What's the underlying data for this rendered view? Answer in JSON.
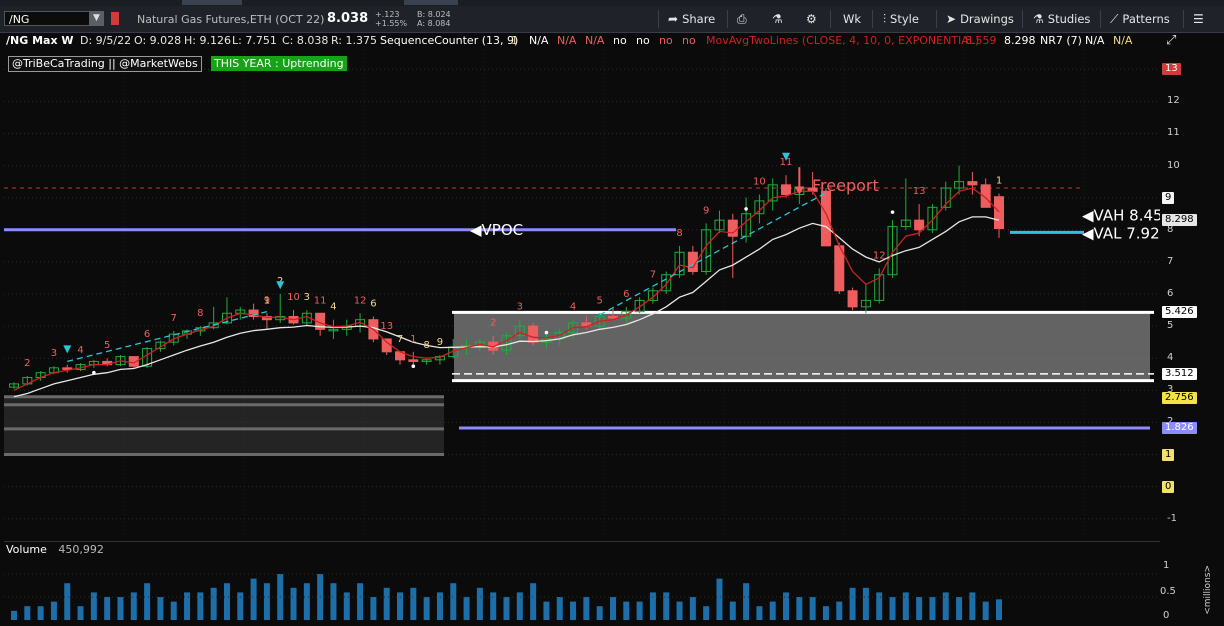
{
  "toolbar": {
    "symbol": "/NG",
    "description": "Natural Gas Futures,ETH (OCT 22)",
    "last": "8.038",
    "change": "+.123",
    "change_pct": "+1.55%",
    "bid": "B: 8.024",
    "ask": "A: 8.084",
    "share": "Share",
    "period": "Wk",
    "style": "Style",
    "drawings": "Drawings",
    "studies": "Studies",
    "patterns": "Patterns"
  },
  "header": {
    "symbol_period": "/NG Max W",
    "date": "D: 9/5/22",
    "open": "O: 9.028",
    "high": "H: 9.126",
    "low": "L: 7.751",
    "close": "C: 8.038",
    "range": "R: 1.375",
    "study1": "SequenceCounter (13, 9)",
    "s1": "1",
    "na1": "N/A",
    "na2": "N/A",
    "na3": "N/A",
    "no1": "no",
    "no2": "no",
    "no3": "no",
    "no4": "no",
    "study2": "MovAvgTwoLines (CLOSE, 4, 10, 0, EXPONENTIAL)",
    "ma1": "8.559",
    "ma2": "8.298",
    "study3": "NR7 (7)",
    "na4": "N/A",
    "na5": "N/A"
  },
  "tags": {
    "author": "@TriBeCaTrading || @MarketWebs",
    "trend": "THIS YEAR : Uptrending"
  },
  "annotations": {
    "vpoc": "VPOC",
    "vah": "VAH  8.45",
    "val": "VAL 7.92",
    "freeport": "Freeport"
  },
  "y_axis": {
    "labels": [
      "13",
      "12",
      "11",
      "10",
      "9",
      "8",
      "7",
      "6",
      "5",
      "4",
      "3",
      "2",
      "1",
      "0",
      "-1"
    ],
    "boxes": {
      "b13": "13",
      "b9": "9",
      "last": "8.298",
      "top": "5.426",
      "mid": "3.512",
      "low": "2.756",
      "vpoc_low": "1.826",
      "one": "1",
      "zero": "0"
    }
  },
  "volume": {
    "label": "Volume",
    "value": "450,992",
    "axis": [
      "1",
      "0.5",
      "0"
    ],
    "unit": "<millions>"
  },
  "colors": {
    "up": "#1fae3a",
    "down": "#ef5e5e",
    "ma_fast": "#d21f1f",
    "ma_slow": "#e6e6e6",
    "cyan": "#29c6d8",
    "vpoc": "#8c8cff",
    "vol": "#1c6fa8"
  },
  "chart_data": {
    "type": "candlestick",
    "candles": [
      [
        3.1,
        3.25,
        3.05,
        3.2
      ],
      [
        3.2,
        3.45,
        3.15,
        3.4
      ],
      [
        3.4,
        3.6,
        3.3,
        3.55
      ],
      [
        3.55,
        3.75,
        3.5,
        3.7
      ],
      [
        3.7,
        3.8,
        3.55,
        3.65
      ],
      [
        3.65,
        3.85,
        3.6,
        3.8
      ],
      [
        3.8,
        3.95,
        3.7,
        3.9
      ],
      [
        3.9,
        4.0,
        3.75,
        3.8
      ],
      [
        3.8,
        4.1,
        3.75,
        4.05
      ],
      [
        4.05,
        4.0,
        3.7,
        3.75
      ],
      [
        3.75,
        4.35,
        3.7,
        4.3
      ],
      [
        4.3,
        4.55,
        4.2,
        4.5
      ],
      [
        4.5,
        4.85,
        4.4,
        4.75
      ],
      [
        4.75,
        4.9,
        4.6,
        4.85
      ],
      [
        4.85,
        5.0,
        4.7,
        4.95
      ],
      [
        4.95,
        5.6,
        4.9,
        5.1
      ],
      [
        5.1,
        5.9,
        5.05,
        5.4
      ],
      [
        5.4,
        5.6,
        5.2,
        5.5
      ],
      [
        5.5,
        5.7,
        5.2,
        5.3
      ],
      [
        5.3,
        5.4,
        4.9,
        5.2
      ],
      [
        5.2,
        6.0,
        5.1,
        5.3
      ],
      [
        5.3,
        5.5,
        5.05,
        5.1
      ],
      [
        5.1,
        5.5,
        5.0,
        5.4
      ],
      [
        5.4,
        5.4,
        4.7,
        4.9
      ],
      [
        4.9,
        5.2,
        4.6,
        4.9
      ],
      [
        4.9,
        5.2,
        4.7,
        5.0
      ],
      [
        5.0,
        5.4,
        4.8,
        5.2
      ],
      [
        5.2,
        5.3,
        4.5,
        4.6
      ],
      [
        4.6,
        4.6,
        4.1,
        4.2
      ],
      [
        4.2,
        4.2,
        3.8,
        3.95
      ],
      [
        3.95,
        4.2,
        3.8,
        3.9
      ],
      [
        3.9,
        4.0,
        3.8,
        3.95
      ],
      [
        3.95,
        4.1,
        3.8,
        4.05
      ],
      [
        4.05,
        4.6,
        4.0,
        4.35
      ],
      [
        4.35,
        4.6,
        4.1,
        4.4
      ],
      [
        4.4,
        4.6,
        4.2,
        4.5
      ],
      [
        4.5,
        4.7,
        4.1,
        4.25
      ],
      [
        4.25,
        4.8,
        4.1,
        4.7
      ],
      [
        4.7,
        5.2,
        4.6,
        5.0
      ],
      [
        5.0,
        5.1,
        4.4,
        4.5
      ],
      [
        4.5,
        4.8,
        4.3,
        4.6
      ],
      [
        4.6,
        4.9,
        4.4,
        4.8
      ],
      [
        4.8,
        5.2,
        4.6,
        5.1
      ],
      [
        5.1,
        5.3,
        4.9,
        5.0
      ],
      [
        5.0,
        5.4,
        4.9,
        5.3
      ],
      [
        5.3,
        5.6,
        5.2,
        5.25
      ],
      [
        5.25,
        5.6,
        5.1,
        5.45
      ],
      [
        5.45,
        5.9,
        5.4,
        5.8
      ],
      [
        5.8,
        6.2,
        5.7,
        6.1
      ],
      [
        6.1,
        6.7,
        6.0,
        6.6
      ],
      [
        6.6,
        7.5,
        6.5,
        7.3
      ],
      [
        7.3,
        7.5,
        6.6,
        6.7
      ],
      [
        6.7,
        8.2,
        6.6,
        8.0
      ],
      [
        8.0,
        8.6,
        7.9,
        8.3
      ],
      [
        8.3,
        8.5,
        6.5,
        7.8
      ],
      [
        7.8,
        9.0,
        7.6,
        8.5
      ],
      [
        8.5,
        9.1,
        8.2,
        8.9
      ],
      [
        8.9,
        9.6,
        8.6,
        9.4
      ],
      [
        9.4,
        9.7,
        9.0,
        9.1
      ],
      [
        9.1,
        9.6,
        8.8,
        9.3
      ],
      [
        9.3,
        9.8,
        9.1,
        9.2
      ],
      [
        9.2,
        9.3,
        7.6,
        7.5
      ],
      [
        7.5,
        7.6,
        6.0,
        6.1
      ],
      [
        6.1,
        6.2,
        5.5,
        5.6
      ],
      [
        5.6,
        6.3,
        5.4,
        5.8
      ],
      [
        5.8,
        6.8,
        5.7,
        6.6
      ],
      [
        6.6,
        8.3,
        6.5,
        8.1
      ],
      [
        8.1,
        9.6,
        8.0,
        8.3
      ],
      [
        8.3,
        8.8,
        7.8,
        8.0
      ],
      [
        8.0,
        8.8,
        7.9,
        8.7
      ],
      [
        8.7,
        9.5,
        8.6,
        9.3
      ],
      [
        9.3,
        10.0,
        9.1,
        9.5
      ],
      [
        9.5,
        9.8,
        9.1,
        9.4
      ],
      [
        9.4,
        9.6,
        8.8,
        8.7
      ],
      [
        9.03,
        9.13,
        7.75,
        8.04
      ]
    ],
    "ma_fast": [
      3.0,
      3.2,
      3.4,
      3.55,
      3.62,
      3.7,
      3.8,
      3.8,
      3.92,
      3.85,
      4.1,
      4.35,
      4.6,
      4.75,
      4.88,
      5.0,
      5.25,
      5.4,
      5.35,
      5.27,
      5.28,
      5.2,
      5.3,
      5.1,
      4.98,
      5.0,
      5.12,
      4.9,
      4.5,
      4.2,
      4.05,
      4.0,
      4.03,
      4.22,
      4.33,
      4.43,
      4.35,
      4.55,
      4.8,
      4.65,
      4.63,
      4.72,
      4.95,
      4.98,
      5.15,
      5.2,
      5.35,
      5.6,
      5.9,
      6.3,
      6.9,
      6.82,
      7.5,
      7.95,
      7.9,
      8.25,
      8.6,
      9.0,
      9.05,
      9.2,
      9.2,
      8.5,
      7.5,
      6.7,
      6.3,
      6.5,
      7.3,
      7.8,
      7.9,
      8.3,
      8.8,
      9.2,
      9.3,
      9.0,
      8.56
    ],
    "ma_slow": [
      2.8,
      2.9,
      3.05,
      3.2,
      3.3,
      3.4,
      3.5,
      3.55,
      3.65,
      3.68,
      3.8,
      3.95,
      4.1,
      4.25,
      4.38,
      4.5,
      4.65,
      4.78,
      4.86,
      4.9,
      4.95,
      4.97,
      5.02,
      4.98,
      4.96,
      4.97,
      5.0,
      4.95,
      4.82,
      4.66,
      4.5,
      4.4,
      4.33,
      4.34,
      4.35,
      4.36,
      4.35,
      4.42,
      4.53,
      4.52,
      4.55,
      4.6,
      4.73,
      4.8,
      4.9,
      4.96,
      5.05,
      5.2,
      5.38,
      5.6,
      5.9,
      6.05,
      6.4,
      6.75,
      6.9,
      7.15,
      7.4,
      7.7,
      7.85,
      8.05,
      8.2,
      8.1,
      7.75,
      7.4,
      7.15,
      7.0,
      7.2,
      7.35,
      7.45,
      7.7,
      7.95,
      8.25,
      8.4,
      8.4,
      8.3
    ],
    "volume": [
      0.2,
      0.3,
      0.3,
      0.4,
      0.8,
      0.3,
      0.6,
      0.5,
      0.5,
      0.6,
      0.8,
      0.5,
      0.4,
      0.6,
      0.6,
      0.7,
      0.8,
      0.6,
      0.9,
      0.8,
      1.0,
      0.7,
      0.8,
      1.0,
      0.8,
      0.6,
      0.8,
      0.5,
      0.7,
      0.6,
      0.7,
      0.5,
      0.6,
      0.8,
      0.5,
      0.7,
      0.6,
      0.5,
      0.6,
      0.8,
      0.4,
      0.5,
      0.4,
      0.5,
      0.3,
      0.5,
      0.4,
      0.4,
      0.6,
      0.6,
      0.4,
      0.5,
      0.3,
      0.9,
      0.4,
      0.8,
      0.3,
      0.4,
      0.6,
      0.5,
      0.5,
      0.3,
      0.4,
      0.7,
      0.7,
      0.6,
      0.5,
      0.6,
      0.5,
      0.5,
      0.6,
      0.5,
      0.6,
      0.4,
      0.45
    ],
    "seq_labels": [
      {
        "i": 1,
        "t": "2",
        "c": "#ef5e5e"
      },
      {
        "i": 3,
        "t": "3",
        "c": "#ef5e5e"
      },
      {
        "i": 5,
        "t": "4",
        "c": "#ef5e5e"
      },
      {
        "i": 7,
        "t": "5",
        "c": "#ef5e5e"
      },
      {
        "i": 10,
        "t": "6",
        "c": "#ef5e5e"
      },
      {
        "i": 12,
        "t": "7",
        "c": "#ef5e5e"
      },
      {
        "i": 14,
        "t": "8",
        "c": "#ef5e5e"
      },
      {
        "i": 19,
        "t": "9",
        "c": "#ef5e5e"
      },
      {
        "i": 21,
        "t": "10",
        "c": "#ef5e5e"
      },
      {
        "i": 23,
        "t": "11",
        "c": "#ef5e5e"
      },
      {
        "i": 26,
        "t": "12",
        "c": "#ef5e5e"
      },
      {
        "i": 28,
        "t": "13",
        "c": "#ef5e5e"
      },
      {
        "i": 30,
        "t": "1",
        "c": "#ef5e5e"
      },
      {
        "i": 22,
        "t": "3",
        "c": "#f2d98a"
      },
      {
        "i": 24,
        "t": "4",
        "c": "#f2d98a"
      },
      {
        "i": 27,
        "t": "6",
        "c": "#f2d98a"
      },
      {
        "i": 29,
        "t": "7",
        "c": "#f2d98a"
      },
      {
        "i": 31,
        "t": "8",
        "c": "#f2d98a"
      },
      {
        "i": 32,
        "t": "9",
        "c": "#f2d98a"
      },
      {
        "i": 20,
        "t": "2",
        "c": "#f2d98a"
      },
      {
        "i": 19,
        "t": "1",
        "c": "#f2d98a"
      },
      {
        "i": 36,
        "t": "2",
        "c": "#ef5e5e"
      },
      {
        "i": 38,
        "t": "3",
        "c": "#ef5e5e"
      },
      {
        "i": 42,
        "t": "4",
        "c": "#ef5e5e"
      },
      {
        "i": 44,
        "t": "5",
        "c": "#ef5e5e"
      },
      {
        "i": 46,
        "t": "6",
        "c": "#ef5e5e"
      },
      {
        "i": 48,
        "t": "7",
        "c": "#ef5e5e"
      },
      {
        "i": 50,
        "t": "8",
        "c": "#ef5e5e"
      },
      {
        "i": 52,
        "t": "9",
        "c": "#ef5e5e"
      },
      {
        "i": 56,
        "t": "10",
        "c": "#ef5e5e"
      },
      {
        "i": 58,
        "t": "11",
        "c": "#ef5e5e"
      },
      {
        "i": 65,
        "t": "12",
        "c": "#ef5e5e"
      },
      {
        "i": 68,
        "t": "13",
        "c": "#ef5e5e"
      },
      {
        "i": 74,
        "t": "1",
        "c": "#f2d98a"
      }
    ],
    "levels": {
      "vah": 8.45,
      "val": 7.92,
      "vpoc": 8.0,
      "box_top": 5.426,
      "box_mid": 3.512,
      "box_low": 3.3,
      "low_vpoc": 1.826
    },
    "ylim": [
      -1.6,
      13.6
    ]
  }
}
